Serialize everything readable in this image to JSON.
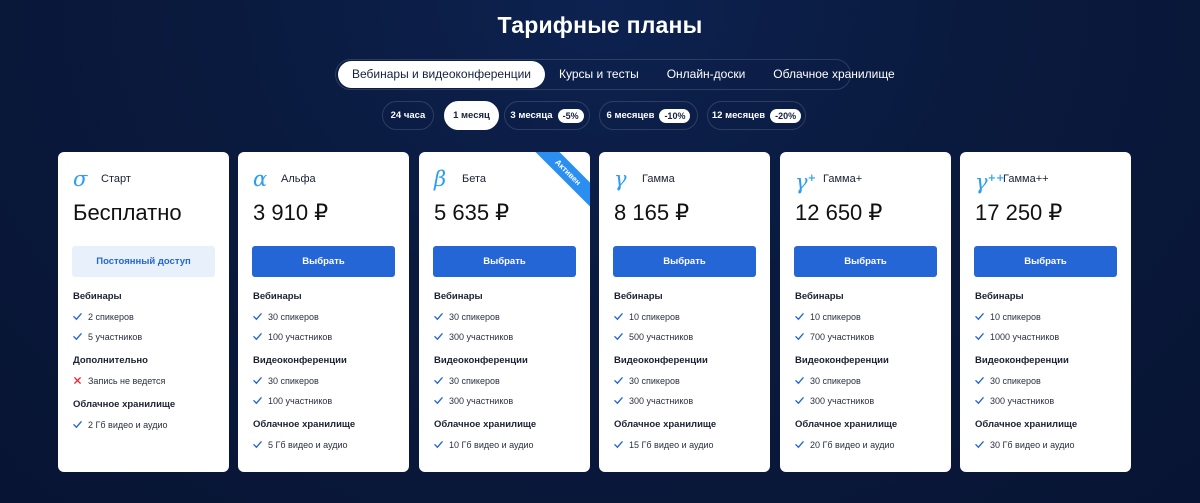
{
  "title": "Тарифные планы",
  "tabs": [
    {
      "label": "Вебинары и видеоконференции",
      "active": true
    },
    {
      "label": "Курсы и тесты",
      "active": false
    },
    {
      "label": "Онлайн-доски",
      "active": false
    },
    {
      "label": "Облачное хранилище",
      "active": false
    }
  ],
  "periods": [
    {
      "label": "24 часа",
      "discount": null,
      "active": false
    },
    {
      "label": "1 месяц",
      "discount": null,
      "active": true
    },
    {
      "label": "3 месяца",
      "discount": "-5%",
      "active": false
    },
    {
      "label": "6 месяцев",
      "discount": "-10%",
      "active": false
    },
    {
      "label": "12 месяцев",
      "discount": "-20%",
      "active": false
    }
  ],
  "colors": {
    "accent": "#2466d6",
    "icon": "#2a9df4",
    "ribbon": "#2a8ff0",
    "check": "#2466d6",
    "cross": "#e0262e"
  },
  "plans": [
    {
      "icon": "sigma-icon",
      "glyph": "σ",
      "name": "Старт",
      "price": "Бесплатно",
      "cta": "Постоянный доступ",
      "cta_style": "free",
      "ribbon": null,
      "sections": [
        {
          "title": "Вебинары",
          "items": [
            {
              "text": "2 спикеров",
              "ok": true
            },
            {
              "text": "5 участников",
              "ok": true
            }
          ]
        },
        {
          "title": "Дополнительно",
          "items": [
            {
              "text": "Запись не ведется",
              "ok": false
            }
          ]
        },
        {
          "title": "Облачное хранилище",
          "items": [
            {
              "text": "2 Гб видео и аудио",
              "ok": true
            }
          ]
        }
      ]
    },
    {
      "icon": "alpha-icon",
      "glyph": "α",
      "name": "Альфа",
      "price": "3 910 ₽",
      "cta": "Выбрать",
      "cta_style": "primary",
      "ribbon": null,
      "sections": [
        {
          "title": "Вебинары",
          "items": [
            {
              "text": "30 спикеров",
              "ok": true
            },
            {
              "text": "100 участников",
              "ok": true
            }
          ]
        },
        {
          "title": "Видеоконференции",
          "items": [
            {
              "text": "30 спикеров",
              "ok": true
            },
            {
              "text": "100 участников",
              "ok": true
            }
          ]
        },
        {
          "title": "Облачное хранилище",
          "items": [
            {
              "text": "5 Гб видео и аудио",
              "ok": true
            }
          ]
        }
      ]
    },
    {
      "icon": "beta-icon",
      "glyph": "β",
      "name": "Бета",
      "price": "5 635 ₽",
      "cta": "Выбрать",
      "cta_style": "primary",
      "ribbon": "Активен",
      "sections": [
        {
          "title": "Вебинары",
          "items": [
            {
              "text": "30 спикеров",
              "ok": true
            },
            {
              "text": "300 участников",
              "ok": true
            }
          ]
        },
        {
          "title": "Видеоконференции",
          "items": [
            {
              "text": "30 спикеров",
              "ok": true
            },
            {
              "text": "300 участников",
              "ok": true
            }
          ]
        },
        {
          "title": "Облачное хранилище",
          "items": [
            {
              "text": "10 Гб видео и аудио",
              "ok": true
            }
          ]
        }
      ]
    },
    {
      "icon": "gamma-icon",
      "glyph": "γ",
      "name": "Гамма",
      "price": "8 165 ₽",
      "cta": "Выбрать",
      "cta_style": "primary",
      "ribbon": null,
      "sections": [
        {
          "title": "Вебинары",
          "items": [
            {
              "text": "10 спикеров",
              "ok": true
            },
            {
              "text": "500 участников",
              "ok": true
            }
          ]
        },
        {
          "title": "Видеоконференции",
          "items": [
            {
              "text": "30 спикеров",
              "ok": true
            },
            {
              "text": "300 участников",
              "ok": true
            }
          ]
        },
        {
          "title": "Облачное хранилище",
          "items": [
            {
              "text": "15 Гб видео и аудио",
              "ok": true
            }
          ]
        }
      ]
    },
    {
      "icon": "gamma-plus-icon",
      "glyph": "γ",
      "glyph_sup": "+",
      "name": "Гамма+",
      "price": "12 650 ₽",
      "cta": "Выбрать",
      "cta_style": "primary",
      "ribbon": null,
      "sections": [
        {
          "title": "Вебинары",
          "items": [
            {
              "text": "10 спикеров",
              "ok": true
            },
            {
              "text": "700 участников",
              "ok": true
            }
          ]
        },
        {
          "title": "Видеоконференции",
          "items": [
            {
              "text": "30 спикеров",
              "ok": true
            },
            {
              "text": "300 участников",
              "ok": true
            }
          ]
        },
        {
          "title": "Облачное хранилище",
          "items": [
            {
              "text": "20 Гб видео и аудио",
              "ok": true
            }
          ]
        }
      ]
    },
    {
      "icon": "gamma-plus-plus-icon",
      "glyph": "γ",
      "glyph_sup": "++",
      "name": "Гамма++",
      "price": "17 250 ₽",
      "cta": "Выбрать",
      "cta_style": "primary",
      "ribbon": null,
      "sections": [
        {
          "title": "Вебинары",
          "items": [
            {
              "text": "10 спикеров",
              "ok": true
            },
            {
              "text": "1000 участников",
              "ok": true
            }
          ]
        },
        {
          "title": "Видеоконференции",
          "items": [
            {
              "text": "30 спикеров",
              "ok": true
            },
            {
              "text": "300 участников",
              "ok": true
            }
          ]
        },
        {
          "title": "Облачное хранилище",
          "items": [
            {
              "text": "30 Гб видео и аудио",
              "ok": true
            }
          ]
        }
      ]
    }
  ]
}
